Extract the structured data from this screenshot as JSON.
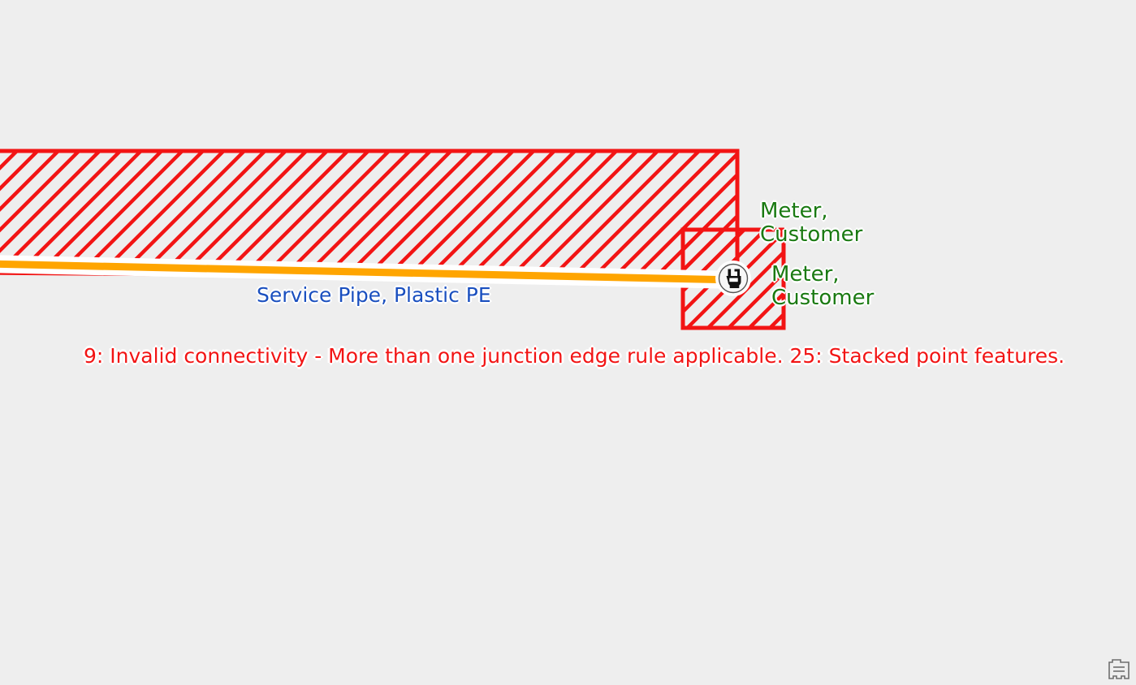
{
  "app": {
    "background_color": "#eeeeee",
    "view_type": "gis-map-canvas"
  },
  "map": {
    "features": [
      {
        "id": "error-polygon-large",
        "kind": "polygon",
        "symbol": "red-diagonal-hatch",
        "stroke_color": "#f21414",
        "hatch_color": "#f21414",
        "label": ""
      },
      {
        "id": "error-polygon-small",
        "kind": "polygon",
        "symbol": "red-diagonal-hatch",
        "stroke_color": "#f21414",
        "hatch_color": "#f21414",
        "label": ""
      },
      {
        "id": "service-pipe-line",
        "kind": "line",
        "symbol": "orange-solid",
        "stroke_color": "#ffa500",
        "halo_color": "#ffffff",
        "label": "Service Pipe, Plastic PE"
      },
      {
        "id": "meter-point-stacked",
        "kind": "point",
        "symbol": "meter-icon",
        "fill_color": "#111111",
        "halo_color": "#ffffff",
        "label": "Meter, Customer"
      }
    ],
    "labels": {
      "meter_customer_1": "Meter,\nCustomer",
      "meter_customer_2": "Meter,\nCustomer",
      "service_pipe": "Service Pipe, Plastic PE",
      "error_message": "9: Invalid connectivity - More than one junction edge rule applicable. 25: Stacked point features."
    },
    "label_colors": {
      "feature_green": "#1a7a12",
      "pipe_blue": "#1a4fbf",
      "error_red": "#f21414",
      "halo": "#ffffff"
    },
    "errors": [
      {
        "code": "9",
        "text": "Invalid connectivity - More than one junction edge rule applicable."
      },
      {
        "code": "25",
        "text": "Stacked point features."
      }
    ]
  },
  "icons": {
    "meter": "meter-icon",
    "overview": "overview-building-icon"
  }
}
